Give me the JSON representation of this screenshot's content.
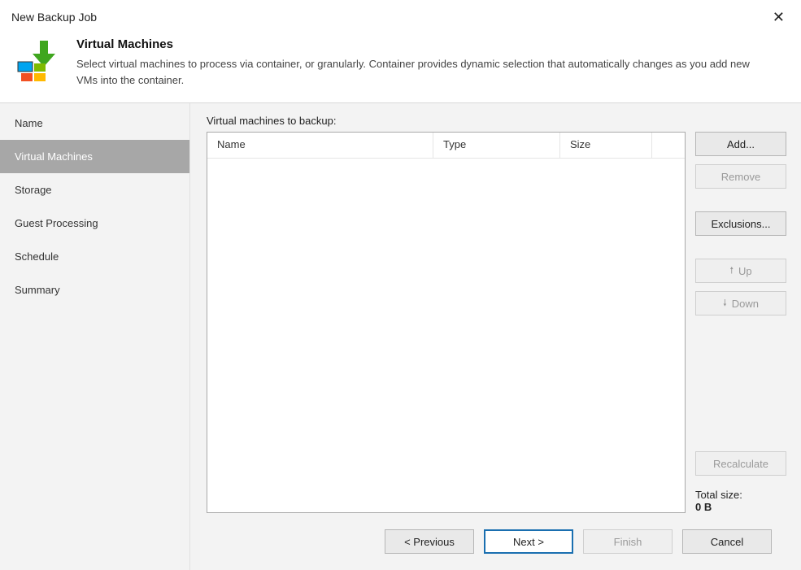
{
  "window": {
    "title": "New Backup Job",
    "close_glyph": "✕"
  },
  "header": {
    "title": "Virtual Machines",
    "description": "Select virtual machines to process via container, or granularly. Container provides dynamic selection that automatically changes as you add new VMs into the container."
  },
  "sidebar": {
    "items": [
      {
        "label": "Name"
      },
      {
        "label": "Virtual Machines"
      },
      {
        "label": "Storage"
      },
      {
        "label": "Guest Processing"
      },
      {
        "label": "Schedule"
      },
      {
        "label": "Summary"
      }
    ],
    "selected_index": 1
  },
  "content": {
    "list_label": "Virtual machines to backup:",
    "columns": {
      "name": "Name",
      "type": "Type",
      "size": "Size"
    }
  },
  "side_buttons": {
    "add": "Add...",
    "remove": "Remove",
    "exclusions": "Exclusions...",
    "up": "Up",
    "up_arrow": "🠕",
    "down": "Down",
    "down_arrow": "🠗",
    "recalculate": "Recalculate",
    "total_label": "Total size:",
    "total_value": "0 B"
  },
  "footer": {
    "previous": "< Previous",
    "next": "Next >",
    "finish": "Finish",
    "cancel": "Cancel"
  }
}
